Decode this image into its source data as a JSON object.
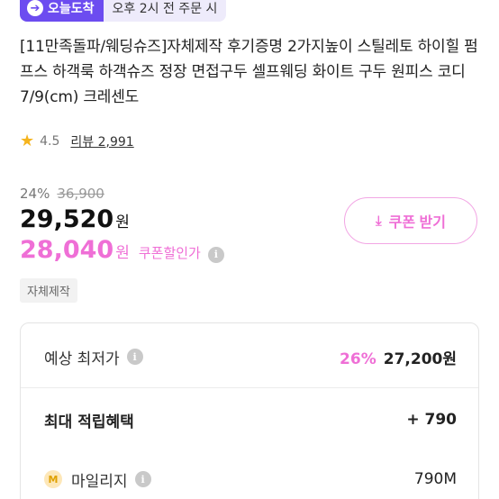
{
  "delivery_badge": {
    "icon": "arrow-right-circle-icon",
    "label": "오늘도착",
    "note": "오후 2시 전 주문 시"
  },
  "product": {
    "title": "[11만족돌파/웨딩슈즈]자체제작 후기증명 2가지높이 스틸레토 하이힐 펌프스 하객룩 하객슈즈 정장 면접구두 셀프웨딩 화이트 구두 원피스 코디 7/9(cm) 크레센도"
  },
  "rating": {
    "icon": "star-icon",
    "score": "4.5",
    "review_label": "리뷰 2,991"
  },
  "price": {
    "discount_rate": "24%",
    "original_price": "36,900",
    "sale_price": "29,520",
    "currency": "원",
    "coupon_price": "28,040",
    "coupon_label": "쿠폰할인가",
    "info_icon": "info-icon",
    "accent_color": "#ef6fd6"
  },
  "coupon_button": {
    "icon": "download-icon",
    "label": "쿠폰 받기"
  },
  "tag": "자체제작",
  "benefits": {
    "lowest_label": "예상 최저가",
    "lowest_rate": "26%",
    "lowest_price": "27,200원",
    "points_label": "최대 적립혜택",
    "points_value": "+ 790",
    "mileage_icon_text": "M",
    "mileage_label": "마일리지",
    "mileage_value": "790M"
  }
}
